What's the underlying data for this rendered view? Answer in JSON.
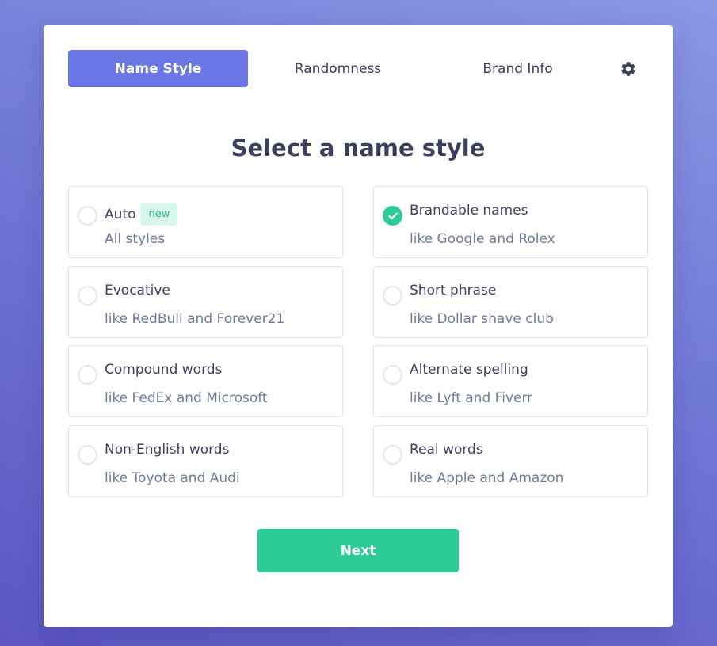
{
  "tabs": [
    {
      "label": "Name Style",
      "active": true
    },
    {
      "label": "Randomness",
      "active": false
    },
    {
      "label": "Brand Info",
      "active": false
    }
  ],
  "settings": {
    "icon": "gear-icon"
  },
  "heading": "Select a name style",
  "options": [
    {
      "name": "Auto",
      "badge": "new",
      "description": "All styles",
      "selected": false
    },
    {
      "name": "Brandable names",
      "description": "like Google and Rolex",
      "selected": true
    },
    {
      "name": "Evocative",
      "description": "like RedBull and Forever21",
      "selected": false
    },
    {
      "name": "Short phrase",
      "description": "like Dollar shave club",
      "selected": false
    },
    {
      "name": "Compound words",
      "description": "like FedEx and Microsoft",
      "selected": false
    },
    {
      "name": "Alternate spelling",
      "description": "like Lyft and Fiverr",
      "selected": false
    },
    {
      "name": "Non-English words",
      "description": "like Toyota and Audi",
      "selected": false
    },
    {
      "name": "Real words",
      "description": "like Apple and Amazon",
      "selected": false
    }
  ],
  "next_label": "Next",
  "colors": {
    "accent": "#6a76e3",
    "success": "#2dcb96",
    "text": "#3b3f5c",
    "muted": "#6e7a99"
  }
}
